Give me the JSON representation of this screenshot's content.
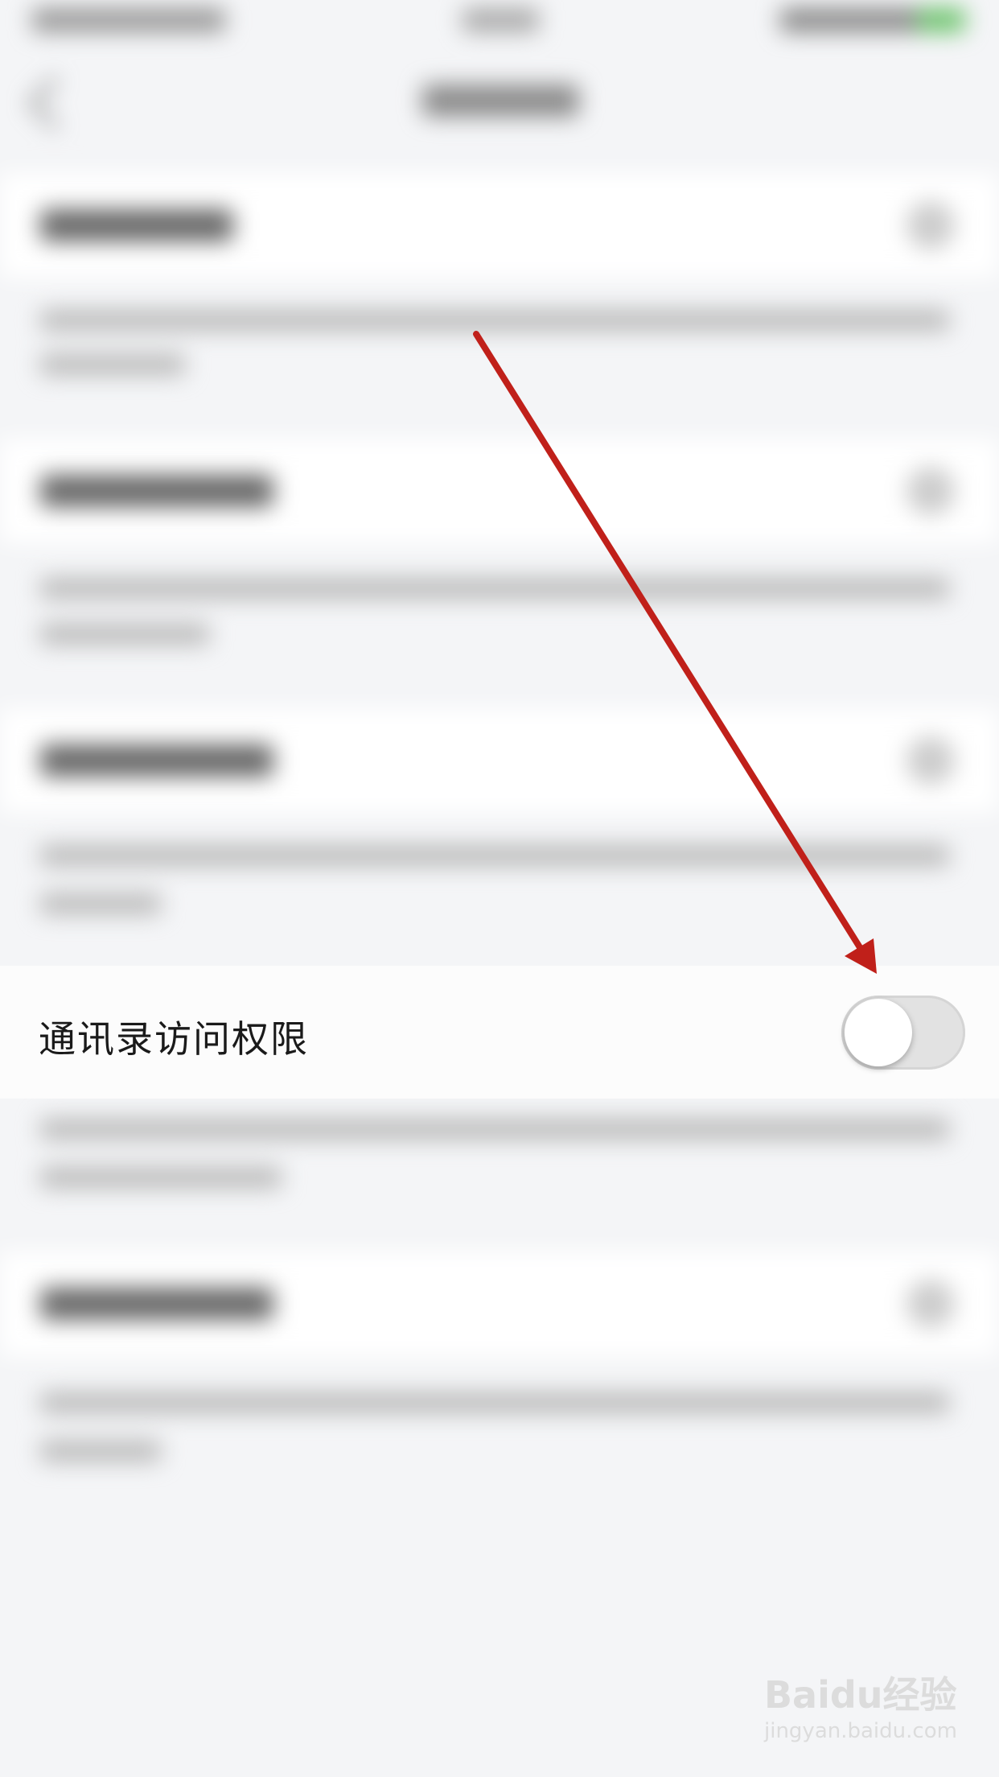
{
  "settings": {
    "contacts_permission_label": "通讯录访问权限",
    "contacts_permission_enabled": false
  },
  "watermark": {
    "logo": "Baidu经验",
    "url": "jingyan.baidu.com"
  },
  "annotation": {
    "arrow_color": "#c0201a"
  }
}
